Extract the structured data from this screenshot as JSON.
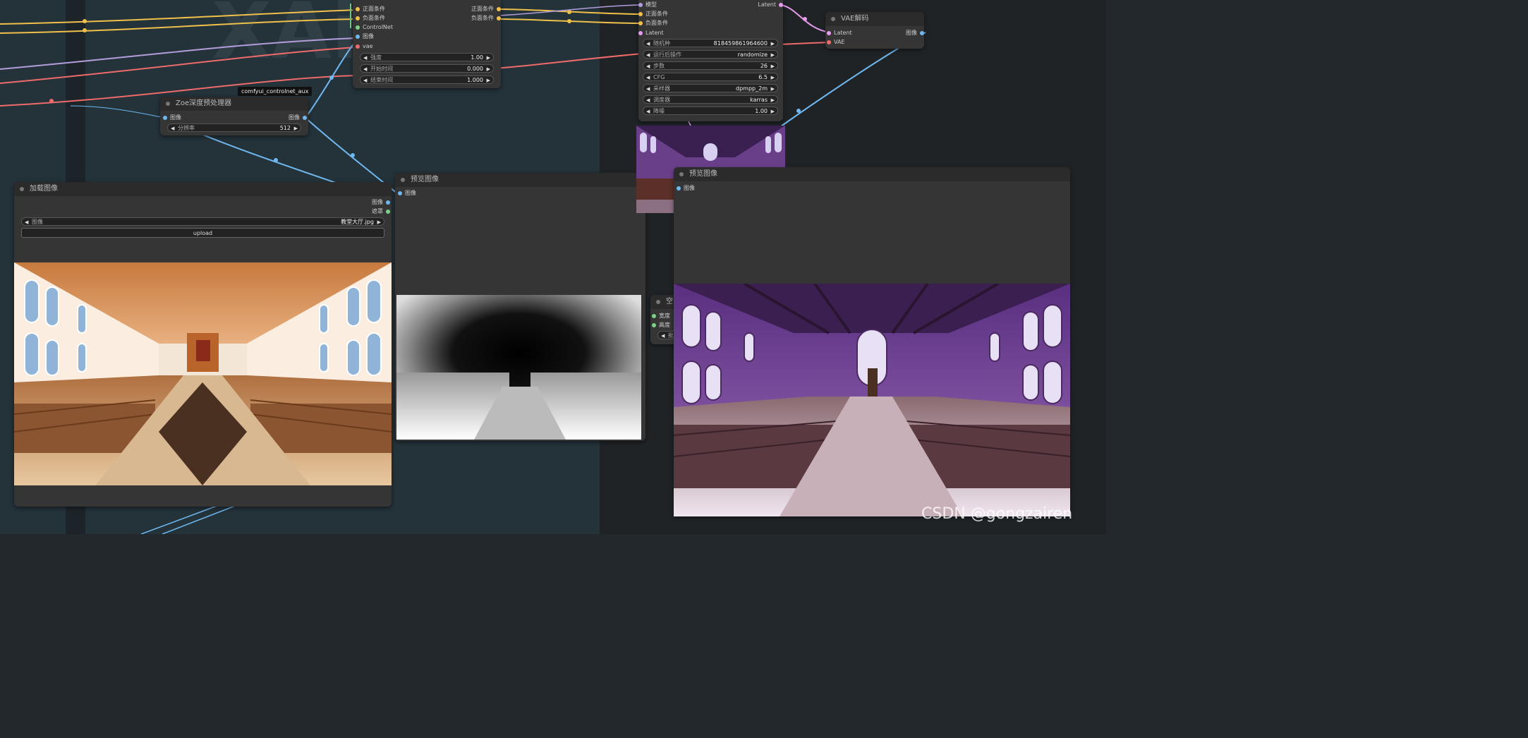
{
  "watermark": "CSDN @gongzairen",
  "controlnet_apply": {
    "inputs": [
      "正面条件",
      "负面条件",
      "ControlNet",
      "图像",
      "vae"
    ],
    "outputs": [
      "正面条件",
      "负面条件"
    ],
    "widgets": [
      {
        "label": "强度",
        "value": "1.00"
      },
      {
        "label": "开始时间",
        "value": "0.000"
      },
      {
        "label": "结束时间",
        "value": "1.000"
      }
    ],
    "tooltip": "comfyui_controlnet_aux"
  },
  "zoe": {
    "title": "Zoe深度预处理器",
    "input": "图像",
    "output": "图像",
    "widget": {
      "label": "分辨率",
      "value": "512"
    }
  },
  "load_image": {
    "title": "加载图像",
    "outputs": [
      "图像",
      "遮罩"
    ],
    "widget": {
      "label": "图像",
      "value": "教堂大厅.jpg"
    },
    "upload_label": "upload"
  },
  "preview_depth": {
    "title": "预览图像",
    "input": "图像"
  },
  "ksampler": {
    "inputs": [
      "模型",
      "正面条件",
      "负面条件",
      "Latent"
    ],
    "output": "Latent",
    "widgets": [
      {
        "label": "随机种",
        "value": "818459861964600"
      },
      {
        "label": "运行后操作",
        "value": "randomize"
      },
      {
        "label": "步数",
        "value": "26"
      },
      {
        "label": "CFG",
        "value": "6.5"
      },
      {
        "label": "采样器",
        "value": "dpmpp_2m"
      },
      {
        "label": "调度器",
        "value": "karras"
      },
      {
        "label": "降噪",
        "value": "1.00"
      }
    ]
  },
  "vae_decode": {
    "title": "VAE解码",
    "inputs": [
      "Latent",
      "VAE"
    ],
    "output": "图像"
  },
  "preview_result": {
    "title": "预览图像",
    "input": "图像"
  },
  "empty_latent": {
    "title_partial": "空L",
    "inputs": [
      "宽度",
      "高度"
    ],
    "widget_partial": "批"
  },
  "colors": {
    "canvas": "#253038",
    "node": "#353535",
    "wire_conditioning": "#f0c04a",
    "wire_image": "#6fb8f0",
    "wire_vae": "#ef6b6b",
    "wire_latent": "#e79cf0",
    "wire_model": "#b39ddb",
    "wire_int": "#7bd389"
  }
}
